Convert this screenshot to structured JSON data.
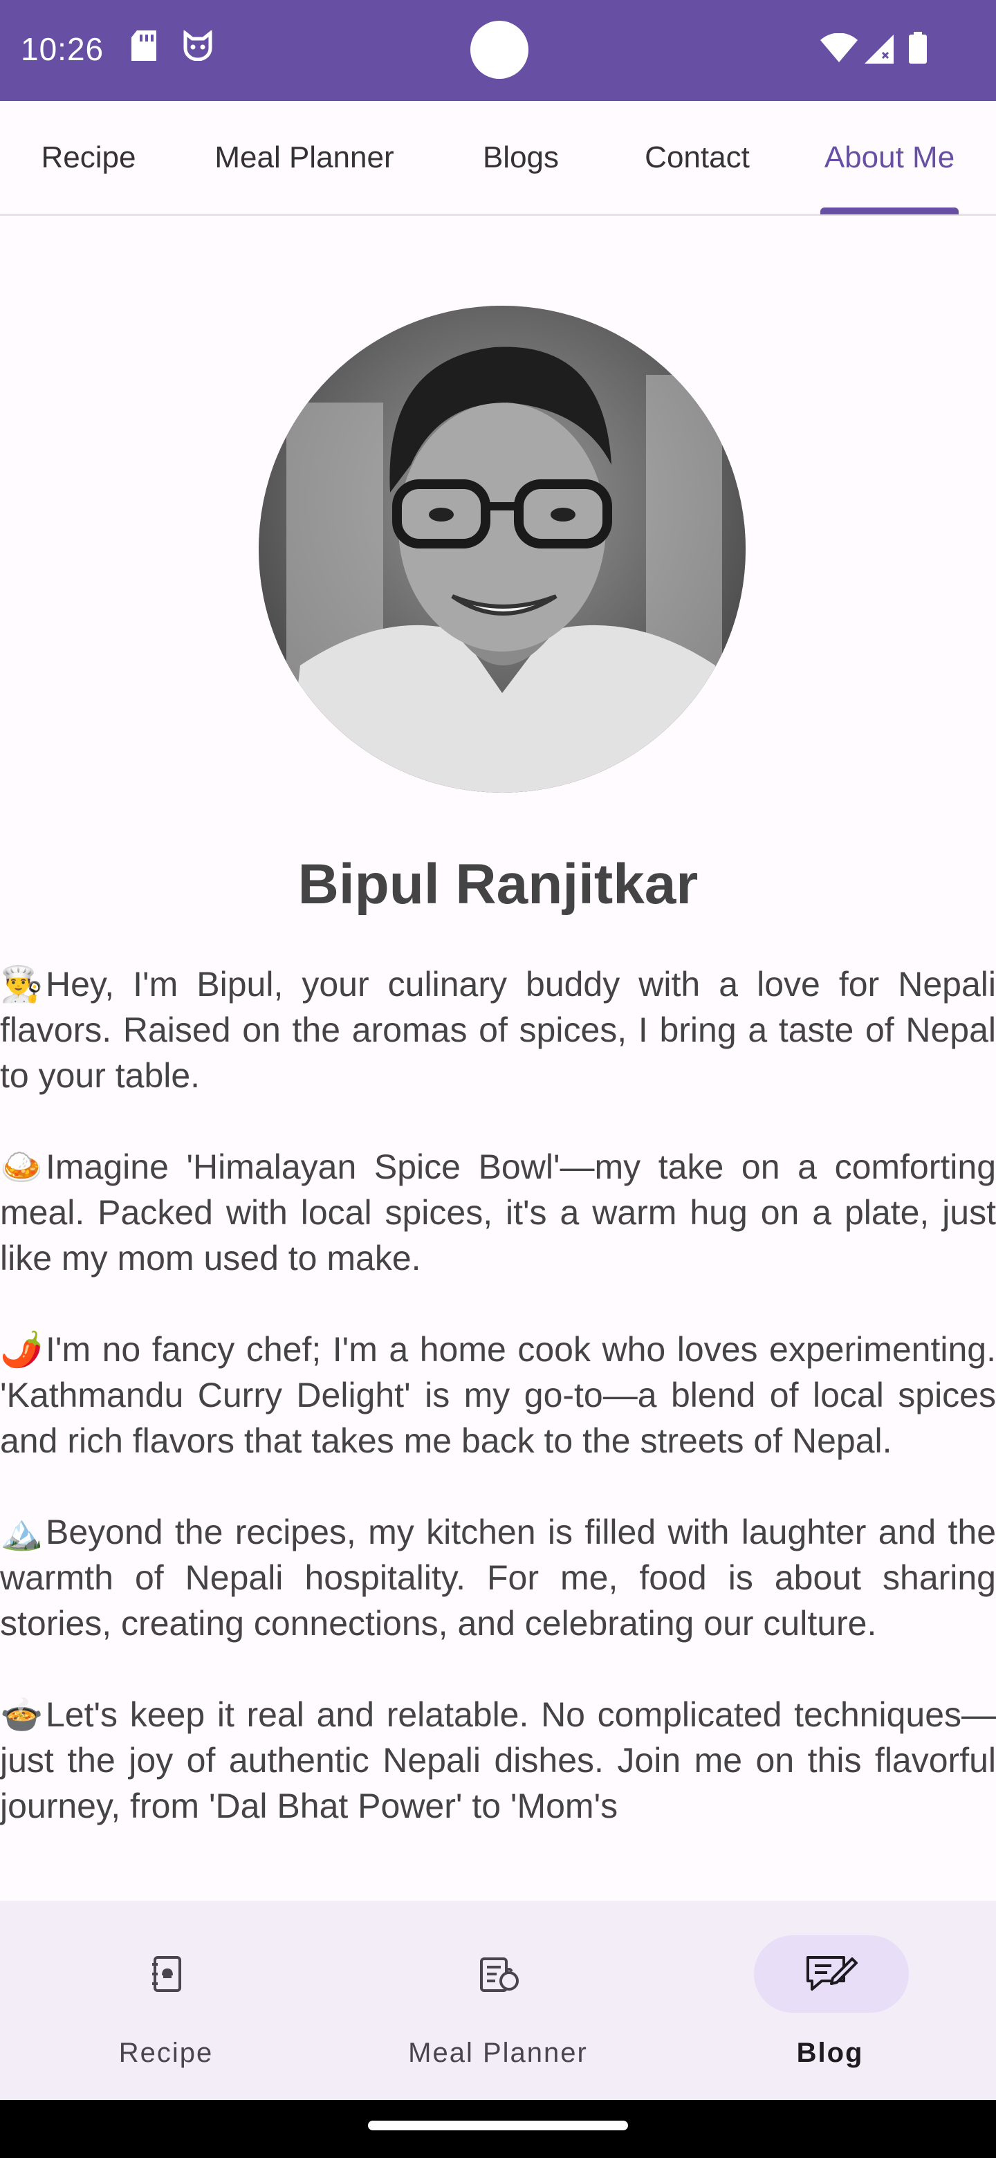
{
  "status_bar": {
    "time": "10:26",
    "icons": [
      "sd-card-icon",
      "cat-face-icon",
      "wifi-icon",
      "signal-icon",
      "battery-icon"
    ],
    "background_color": "#6750a4"
  },
  "tabs": [
    {
      "label": "Recipe",
      "active": false
    },
    {
      "label": "Meal Planner",
      "active": false
    },
    {
      "label": "Blogs",
      "active": false
    },
    {
      "label": "Contact",
      "active": false
    },
    {
      "label": "About Me",
      "active": true
    }
  ],
  "profile": {
    "name": "Bipul Ranjitkar",
    "avatar": "profile-photo"
  },
  "bio": [
    {
      "emoji": "👨‍🍳",
      "text": "Hey, I'm Bipul, your culinary buddy with a love for Nepali flavors. Raised on the aromas of spices, I bring a taste of Nepal to your table."
    },
    {
      "emoji": "🍛",
      "text": "Imagine 'Himalayan Spice Bowl'—my take on a comforting meal. Packed with local spices, it's a warm hug on a plate, just like my mom used to make."
    },
    {
      "emoji": "🌶️",
      "text": "I'm no fancy chef; I'm a home cook who loves experimenting. 'Kathmandu Curry Delight' is my go-to—a blend of local spices and rich flavors that takes me back to the streets of Nepal."
    },
    {
      "emoji": "🏔️",
      "text": "Beyond the recipes, my kitchen is filled with laughter and the warmth of Nepali hospitality. For me, food is about sharing stories, creating connections, and celebrating our culture."
    },
    {
      "emoji": "🍲",
      "text": "Let's keep it real and relatable. No complicated techniques—just the joy of authentic Nepali dishes. Join me on this flavorful journey, from 'Dal Bhat Power' to 'Mom's"
    }
  ],
  "bottom_nav": [
    {
      "label": "Recipe",
      "icon": "recipe-book-icon",
      "active": false
    },
    {
      "label": "Meal Planner",
      "icon": "meal-planner-icon",
      "active": false
    },
    {
      "label": "Blog",
      "icon": "blog-edit-icon",
      "active": true
    }
  ],
  "colors": {
    "accent": "#6750a4",
    "nav_active_pill": "#e8def8",
    "nav_background": "#f3edf7"
  }
}
